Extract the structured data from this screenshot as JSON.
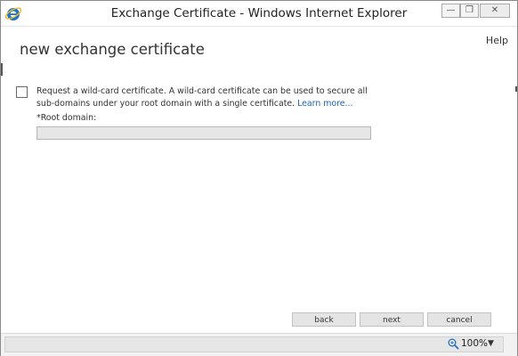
{
  "window": {
    "title": "Exchange Certificate - Windows Internet Explorer",
    "minimize_glyph": "—",
    "restore_glyph": "❐",
    "close_glyph": "✕"
  },
  "page": {
    "help_label": "Help",
    "title": "new exchange certificate"
  },
  "wildcard": {
    "checked": false,
    "description": "Request a wild-card certificate. A wild-card certificate can be used to secure all sub-domains under your root domain with a single certificate. ",
    "learn_more": "Learn more..."
  },
  "root_domain": {
    "label": "*Root domain:",
    "value": ""
  },
  "buttons": {
    "back": "back",
    "next": "next",
    "cancel": "cancel"
  },
  "status": {
    "zoom": "100%",
    "dropdown_glyph": "▼"
  },
  "colors": {
    "link": "#1d63b5",
    "ie_blue": "#1e74c9",
    "ie_ring": "#f2b824"
  },
  "icons": [
    "ie-logo-icon",
    "minimize-icon",
    "restore-icon",
    "close-icon",
    "zoom-icon",
    "chevron-down-icon"
  ]
}
